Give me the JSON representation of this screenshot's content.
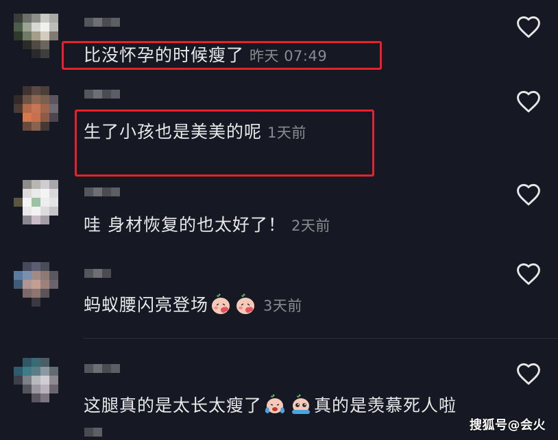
{
  "comments": [
    {
      "text": "比没怀孕的时候瘦了",
      "time": "昨天 07:49",
      "highlighted": true
    },
    {
      "text": "生了小孩也是美美的呢",
      "time": "1天前",
      "highlighted": true
    },
    {
      "text": "哇 身材恢复的也太好了！",
      "time": "2天前",
      "highlighted": false
    },
    {
      "text": "蚂蚁腰闪亮登场",
      "time": "3天前",
      "emojis": [
        "shy-face-emoji",
        "shy-face-emoji"
      ],
      "highlighted": false
    },
    {
      "text_before": "这腿真的是太长太瘦了",
      "text_after": "真的是羡慕死人啦",
      "emojis": [
        "crying-face-emoji",
        "pleading-face-emoji"
      ],
      "highlighted": false
    }
  ],
  "watermark": "搜狐号@会火",
  "colors": {
    "background": "#161823",
    "highlight": "#e8222a",
    "meta": "#8a8b91"
  },
  "icons": {
    "like": "heart-outline-icon"
  }
}
